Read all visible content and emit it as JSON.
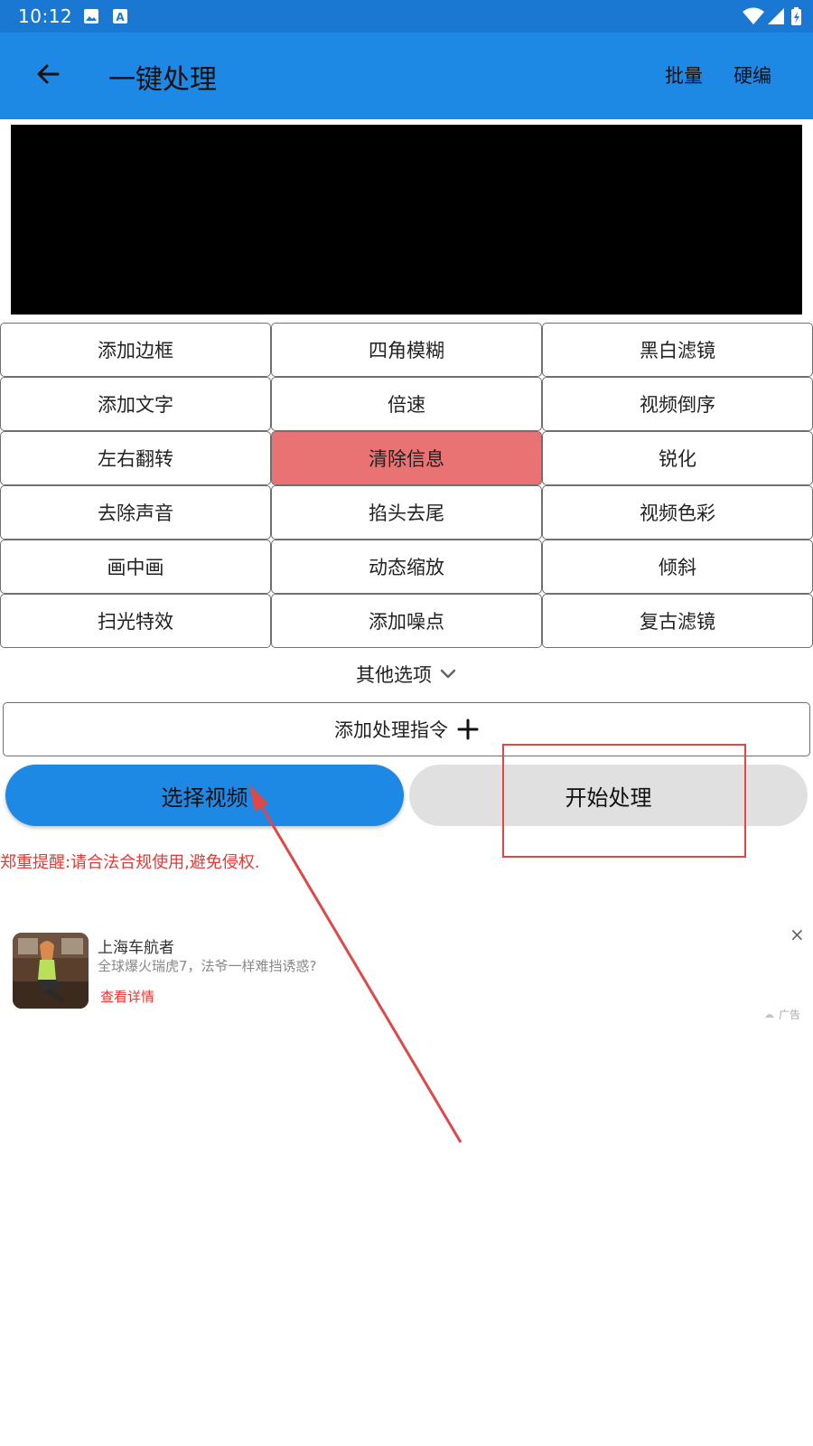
{
  "status_bar": {
    "time": "10:12",
    "icons": [
      "image-icon",
      "a-badge-icon",
      "wifi-icon",
      "signal-icon",
      "battery-charging-icon"
    ]
  },
  "app_bar": {
    "title": "一键处理",
    "actions": [
      "批量",
      "硬编"
    ]
  },
  "operations": [
    {
      "label": "添加边框",
      "active": false
    },
    {
      "label": "四角模糊",
      "active": false
    },
    {
      "label": "黑白滤镜",
      "active": false
    },
    {
      "label": "添加文字",
      "active": false
    },
    {
      "label": "倍速",
      "active": false
    },
    {
      "label": "视频倒序",
      "active": false
    },
    {
      "label": "左右翻转",
      "active": false
    },
    {
      "label": "清除信息",
      "active": true
    },
    {
      "label": "锐化",
      "active": false
    },
    {
      "label": "去除声音",
      "active": false
    },
    {
      "label": "掐头去尾",
      "active": false
    },
    {
      "label": "视频色彩",
      "active": false
    },
    {
      "label": "画中画",
      "active": false
    },
    {
      "label": "动态缩放",
      "active": false
    },
    {
      "label": "倾斜",
      "active": false
    },
    {
      "label": "扫光特效",
      "active": false
    },
    {
      "label": "添加噪点",
      "active": false
    },
    {
      "label": "复古滤镜",
      "active": false
    }
  ],
  "other_options": "其他选项",
  "add_command": "添加处理指令",
  "select_video": "选择视频",
  "start_process": "开始处理",
  "notice": "郑重提醒:请合法合规使用,避免侵权.",
  "ad": {
    "title": "上海车航者",
    "subtitle": "全球爆火瑞虎7，法爷一样难挡诱惑?",
    "link": "查看详情",
    "close": "×",
    "tag": "广告"
  },
  "colors": {
    "appbar": "#1e88e5",
    "statusbar": "#1a77d2",
    "active_op": "#e97272",
    "annotation": "#e04848",
    "notice": "#e53935"
  }
}
